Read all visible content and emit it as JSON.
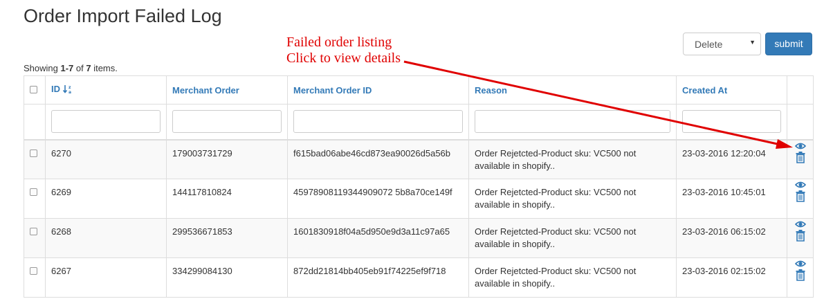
{
  "page": {
    "title": "Order Import Failed Log"
  },
  "annotation": {
    "line1": "Failed order listing",
    "line2": "Click to view details",
    "color": "#e00000"
  },
  "bulk_action": {
    "selected": "Delete",
    "submit_label": "submit"
  },
  "summary": {
    "prefix": "Showing ",
    "range": "1-7",
    "middle": " of ",
    "total": "7",
    "suffix": " items."
  },
  "table": {
    "columns": [
      "ID",
      "Merchant Order",
      "Merchant Order ID",
      "Reason",
      "Created At"
    ],
    "rows": [
      {
        "id": "6270",
        "merchant_order": "179003731729",
        "merchant_order_id": "f615bad06abe46cd873ea90026d5a56b",
        "reason": "Order Rejetcted-Product sku: VC500 not available in shopify..",
        "created_at": "23-03-2016 12:20:04"
      },
      {
        "id": "6269",
        "merchant_order": "144117810824",
        "merchant_order_id": "45978908119344909072 5b8a70ce149f",
        "reason": "Order Rejetcted-Product sku: VC500 not available in shopify..",
        "created_at": "23-03-2016 10:45:01"
      },
      {
        "id": "6268",
        "merchant_order": "299536671853",
        "merchant_order_id": "1601830918f04a5d950e9d3a11c97a65",
        "reason": "Order Rejetcted-Product sku: VC500 not available in shopify..",
        "created_at": "23-03-2016 06:15:02"
      },
      {
        "id": "6267",
        "merchant_order": "334299084130",
        "merchant_order_id": "872dd21814bb405eb91f74225ef9f718",
        "reason": "Order Rejetcted-Product sku: VC500 not available in shopify..",
        "created_at": "23-03-2016 02:15:02"
      }
    ]
  },
  "colors": {
    "link": "#337ab7",
    "button": "#337ab7",
    "annotation_red": "#e00000"
  },
  "icons": {
    "sort": "sort-numeric-asc-icon",
    "view": "eye-icon",
    "delete": "trash-icon"
  }
}
